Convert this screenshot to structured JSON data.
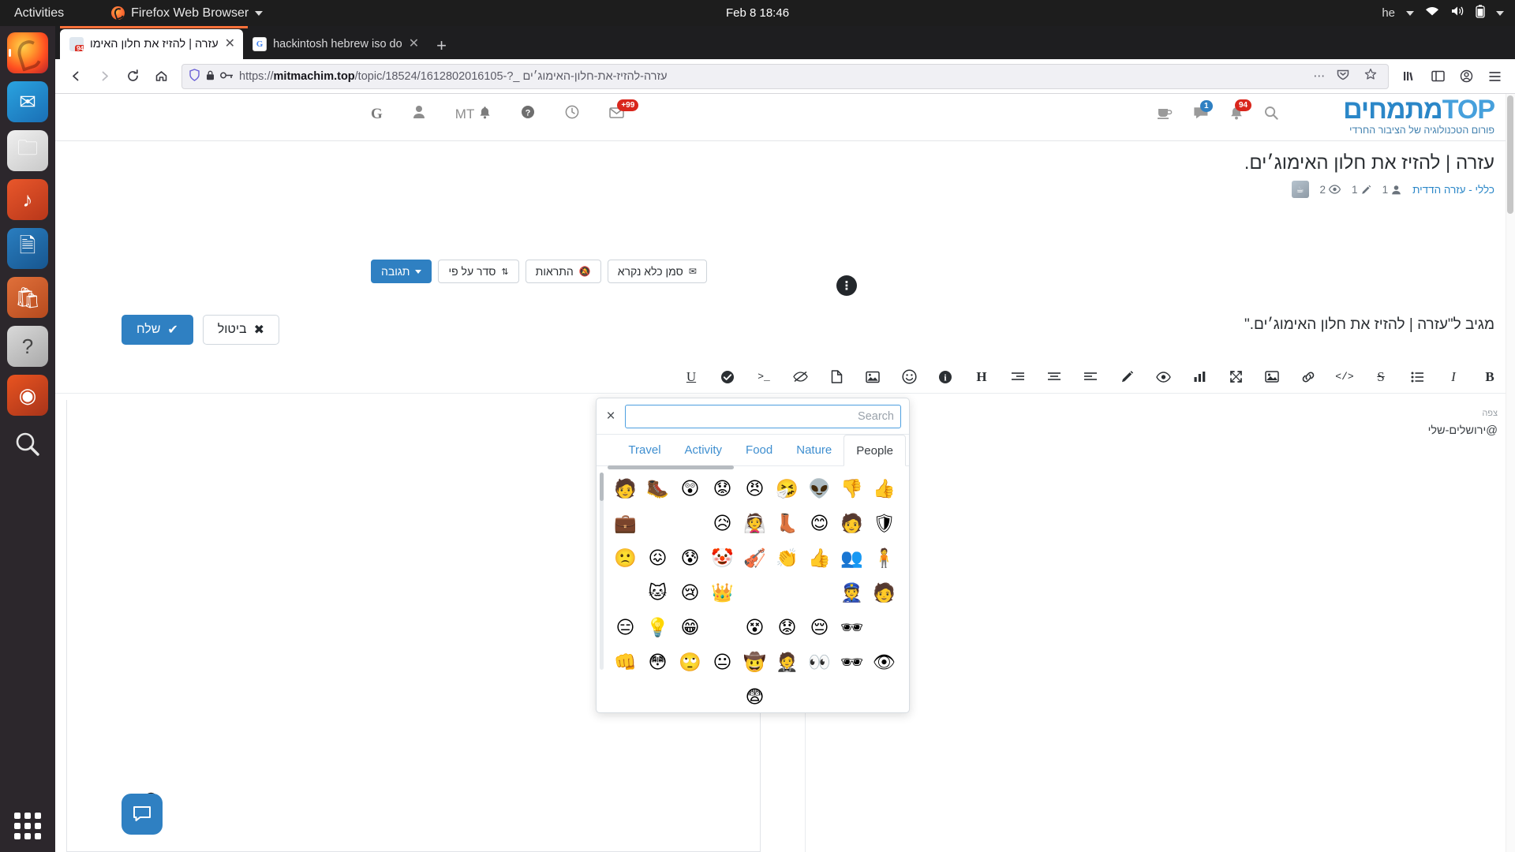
{
  "gnome": {
    "activities": "Activities",
    "app_menu": "Firefox Web Browser",
    "clock": "Feb 8  18:46",
    "language": "he"
  },
  "dock": {
    "items": [
      {
        "name": "firefox",
        "label": "Firefox"
      },
      {
        "name": "thunderbird",
        "label": "Thunderbird Mail"
      },
      {
        "name": "files",
        "label": "Files"
      },
      {
        "name": "rhythmbox",
        "label": "Rhythmbox"
      },
      {
        "name": "libreoffice-writer",
        "label": "LibreOffice Writer"
      },
      {
        "name": "ubuntu-software",
        "label": "Ubuntu Software"
      },
      {
        "name": "help",
        "label": "Help"
      },
      {
        "name": "ubuntu-about",
        "label": "About Ubuntu"
      },
      {
        "name": "search",
        "label": "Search"
      }
    ],
    "show_apps": "Show Applications"
  },
  "browser": {
    "tabs": [
      {
        "title": "עזרה | להזיז את חלון האימו",
        "favicon": "mitmachim",
        "badge": "94",
        "active": true
      },
      {
        "title": "hackintosh hebrew iso do",
        "favicon": "google",
        "active": false
      }
    ],
    "new_tab": "+",
    "nav": {
      "back": "←",
      "forward": "→",
      "reload": "⟳",
      "home": "⌂",
      "shield": "shield-icon",
      "lock": "lock-icon",
      "key": "key-icon"
    },
    "url": {
      "scheme": "https://",
      "host": "mitmachim.top",
      "path": "/topic/18524/1612802016105-?_",
      "hebrew": "עזרה-להזיז-את-חלון-האימוג׳ים"
    },
    "toolbar_right": [
      "…",
      "pocket-icon",
      "bookmark-star-icon"
    ],
    "end_icons": [
      "library-icon",
      "sidebar-icon",
      "account-icon",
      "menu-icon"
    ]
  },
  "forum": {
    "logo_brand": "מתמחים",
    "logo_top": "TOP",
    "tagline": "פורום הטכנולוגיה של הציבור החרדי",
    "right_icons": [
      {
        "name": "coffee-icon",
        "glyph": "☕"
      },
      {
        "name": "chat-icon",
        "glyph": "💬",
        "count": "1"
      },
      {
        "name": "bell-icon",
        "glyph": "🔔",
        "count": "94"
      },
      {
        "name": "search-icon",
        "glyph": "🔍"
      }
    ],
    "left_icons": [
      {
        "name": "google-icon",
        "glyph": "G"
      },
      {
        "name": "user-icon",
        "glyph": "👤"
      },
      {
        "name": "mt-label",
        "glyph": "MT"
      },
      {
        "name": "notification-bell-icon",
        "glyph": "🔔"
      },
      {
        "name": "help-icon",
        "glyph": "?"
      },
      {
        "name": "clock-icon",
        "glyph": "🕐"
      },
      {
        "name": "inbox-icon",
        "glyph": "📥",
        "count": "+99"
      }
    ],
    "mask_badge": "mask-icon"
  },
  "topic": {
    "title": "עזרה | להזיז את חלון האימוג׳ים.",
    "category": "כללי - עזרה הדדית",
    "views": "2",
    "posts": "1",
    "users": "1"
  },
  "composer": {
    "drag_handle": "⋮",
    "buttons_right": [
      {
        "name": "tagged-button",
        "label": "תגובה",
        "chevron": true,
        "primary": true
      },
      {
        "name": "sort-by-button",
        "label": "סדר על פי",
        "chevron": true
      },
      {
        "name": "translate-button",
        "label": "התראות"
      },
      {
        "name": "mark-unread-button",
        "label": "סמן כלא נקרא"
      }
    ],
    "send_label": "שלח",
    "send_icon": "✔",
    "cancel_label": "ביטול",
    "cancel_icon": "✖",
    "replying_to": "מגיב ל\"עזרה | להזיז את חלון האימוג׳ים.\"",
    "toolbar_icons": [
      {
        "name": "bold-icon",
        "glyph": "B"
      },
      {
        "name": "italic-icon",
        "glyph": "I"
      },
      {
        "name": "list-icon",
        "glyph": "☰"
      },
      {
        "name": "strikethrough-icon",
        "glyph": "S"
      },
      {
        "name": "code-icon",
        "glyph": "</>"
      },
      {
        "name": "link-icon",
        "glyph": "🔗"
      },
      {
        "name": "image-icon",
        "glyph": "🖼"
      },
      {
        "name": "fullscreen-icon",
        "glyph": "⛶"
      },
      {
        "name": "poll-icon",
        "glyph": "📊"
      },
      {
        "name": "preview-icon",
        "glyph": "👁"
      },
      {
        "name": "highlight-icon",
        "glyph": "✒"
      },
      {
        "name": "align-left-icon",
        "glyph": "≡"
      },
      {
        "name": "align-center-icon",
        "glyph": "≡"
      },
      {
        "name": "align-right-icon",
        "glyph": "≡"
      },
      {
        "name": "heading-icon",
        "glyph": "H"
      },
      {
        "name": "info-icon",
        "glyph": "ℹ"
      },
      {
        "name": "emoji-icon",
        "glyph": "☺"
      },
      {
        "name": "attach-image-icon",
        "glyph": "🖻"
      },
      {
        "name": "file-icon",
        "glyph": "📄"
      },
      {
        "name": "spoiler-icon",
        "glyph": "👁"
      },
      {
        "name": "terminal-icon",
        "glyph": ">_"
      },
      {
        "name": "check-icon",
        "glyph": "✔"
      },
      {
        "name": "underline-icon",
        "glyph": "U"
      }
    ],
    "signature_label": "צפה",
    "signature_user": "@ירושלים-שלי"
  },
  "emoji_picker": {
    "close_label": "×",
    "search_placeholder": "Search",
    "search_value": "",
    "tabs": [
      {
        "label": "People",
        "active": true
      },
      {
        "label": "Nature",
        "active": false
      },
      {
        "label": "Food",
        "active": false
      },
      {
        "label": "Activity",
        "active": false
      },
      {
        "label": "Travel",
        "active": false
      }
    ],
    "rows": [
      [
        "👍",
        "👎",
        "👽",
        "🤧",
        "😠",
        "😟",
        "😲",
        "🥾",
        "🧑"
      ],
      [
        "🛡",
        "🧑",
        "😊",
        "👢",
        "👰",
        "😥",
        "",
        "",
        "💼"
      ],
      [
        "🧍",
        "👥",
        "👍",
        "👏",
        "🎻",
        "🤡",
        "😰",
        "😖",
        "🙁"
      ],
      [
        "🧑",
        "👮",
        "",
        "",
        "",
        "👑",
        "😢",
        "🐱",
        ""
      ],
      [
        "",
        "🕶",
        "😔",
        "😟",
        "😵",
        "",
        "😁",
        "💡",
        "😑"
      ],
      [
        "👁",
        "🕶",
        "👀",
        "🤵",
        "🤠",
        "😐",
        "🙄",
        "😳",
        "👊"
      ],
      [
        "",
        "",
        "",
        "",
        "😨",
        "",
        "",
        "",
        ""
      ]
    ]
  },
  "chat_widget": {
    "bubble_icon": "💬",
    "eye_icon": "👁"
  }
}
